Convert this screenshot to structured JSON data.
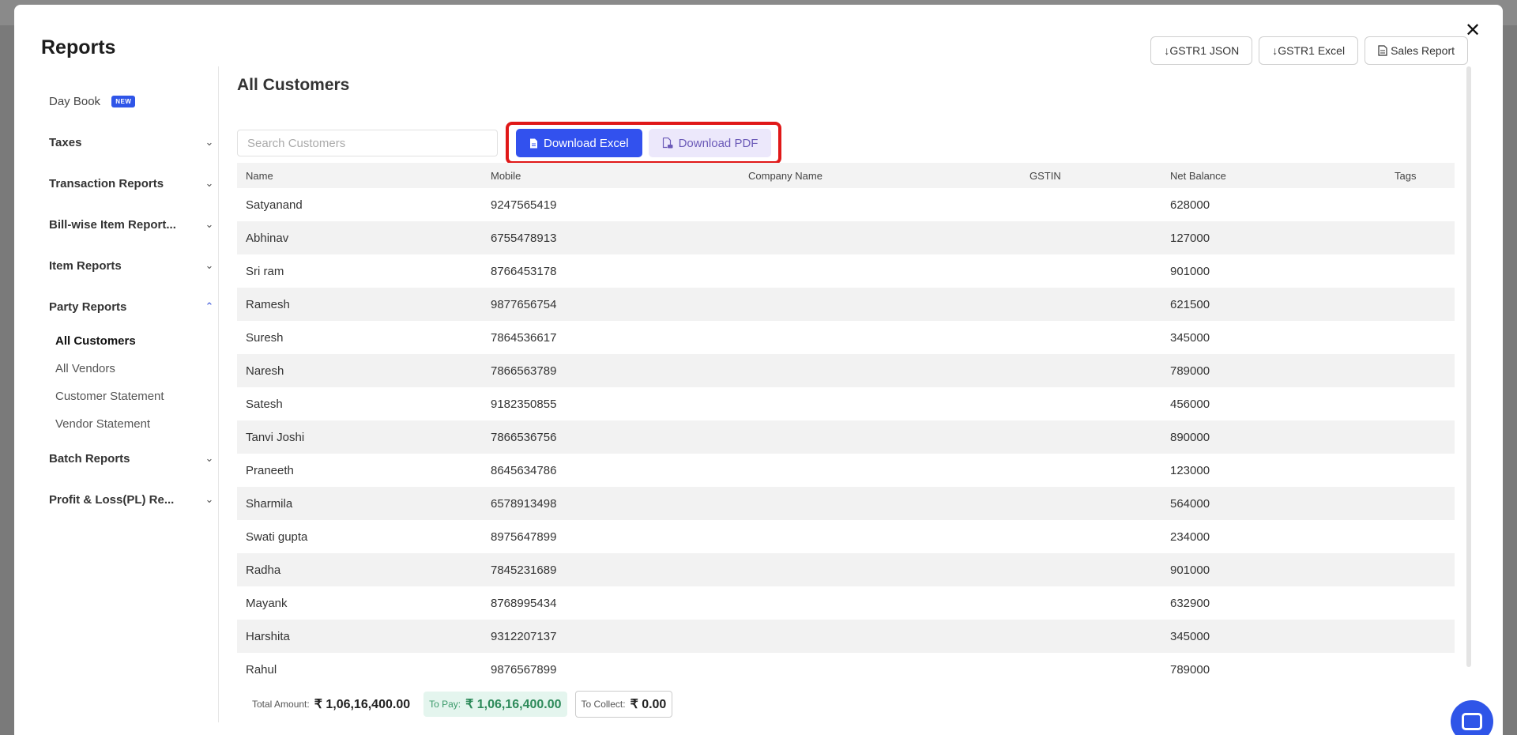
{
  "modal": {
    "title": "Reports",
    "close_label": "✕",
    "top_buttons": [
      {
        "label": "↓GSTR1 JSON"
      },
      {
        "label": "↓GSTR1 Excel"
      },
      {
        "label": "Sales Report"
      }
    ]
  },
  "sidebar": {
    "day_book": {
      "label": "Day Book",
      "badge": "NEW"
    },
    "sections": [
      {
        "label": "Taxes",
        "chev": "⌄"
      },
      {
        "label": "Transaction Reports",
        "chev": "⌄"
      },
      {
        "label": "Bill-wise Item Report...",
        "chev": "⌄"
      },
      {
        "label": "Item Reports",
        "chev": "⌄"
      },
      {
        "label": "Party Reports",
        "chev": "⌃"
      },
      {
        "label": "Batch Reports",
        "chev": "⌄"
      },
      {
        "label": "Profit & Loss(PL) Re...",
        "chev": "⌄"
      }
    ],
    "party_sub_items": [
      {
        "label": "All Customers"
      },
      {
        "label": "All Vendors"
      },
      {
        "label": "Customer Statement"
      },
      {
        "label": "Vendor Statement"
      }
    ]
  },
  "main": {
    "title": "All Customers",
    "search": {
      "placeholder": "Search Customers",
      "value": ""
    },
    "download_excel_label": "Download Excel",
    "download_pdf_label": "Download PDF",
    "columns": [
      "Name",
      "Mobile",
      "Company Name",
      "GSTIN",
      "Net Balance",
      "Tags"
    ],
    "rows": [
      [
        "Satyanand",
        "9247565419",
        "",
        "",
        "628000",
        ""
      ],
      [
        "Abhinav",
        "6755478913",
        "",
        "",
        "127000",
        ""
      ],
      [
        "Sri ram",
        "8766453178",
        "",
        "",
        "901000",
        ""
      ],
      [
        "Ramesh",
        "9877656754",
        "",
        "",
        "621500",
        ""
      ],
      [
        "Suresh",
        "7864536617",
        "",
        "",
        "345000",
        ""
      ],
      [
        "Naresh",
        "7866563789",
        "",
        "",
        "789000",
        ""
      ],
      [
        "Satesh",
        "9182350855",
        "",
        "",
        "456000",
        ""
      ],
      [
        "Tanvi Joshi",
        "7866536756",
        "",
        "",
        "890000",
        ""
      ],
      [
        "Praneeth",
        "8645634786",
        "",
        "",
        "123000",
        ""
      ],
      [
        "Sharmila",
        "6578913498",
        "",
        "",
        "564000",
        ""
      ],
      [
        "Swati gupta",
        "8975647899",
        "",
        "",
        "234000",
        ""
      ],
      [
        "Radha",
        "7845231689",
        "",
        "",
        "901000",
        ""
      ],
      [
        "Mayank",
        "8768995434",
        "",
        "",
        "632900",
        ""
      ],
      [
        "Harshita",
        "9312207137",
        "",
        "",
        "345000",
        ""
      ],
      [
        "Rahul",
        "9876567899",
        "",
        "",
        "789000",
        ""
      ]
    ],
    "totals": {
      "total_label": "Total Amount:",
      "total_value": "₹ 1,06,16,400.00",
      "to_pay_label": "To Pay:",
      "to_pay_value": "₹ 1,06,16,400.00",
      "to_collect_label": "To Collect:",
      "to_collect_value": "₹ 0.00"
    }
  },
  "colors": {
    "primary": "#3251ee",
    "highlight_border": "#e01818",
    "pdf_bg": "#ece8fb"
  }
}
